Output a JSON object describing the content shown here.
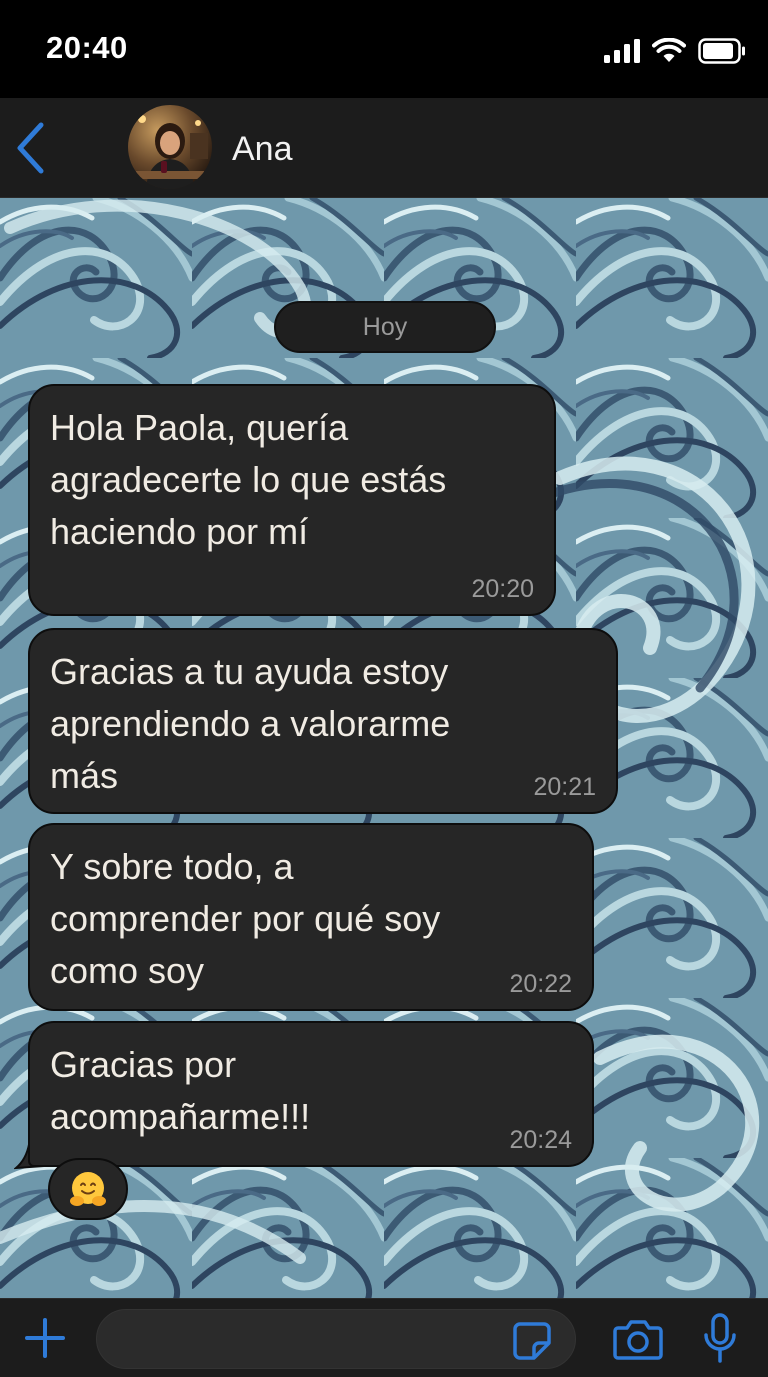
{
  "status_bar": {
    "time": "20:40"
  },
  "header": {
    "contact_name": "Ana"
  },
  "chat": {
    "date_separator": "Hoy",
    "messages": [
      {
        "text": "Hola Paola, quería\nagradecerte lo que estás\nhaciendo por mí",
        "time": "20:20"
      },
      {
        "text": "Gracias a tu ayuda estoy\naprendiendo a valorarme\nmás",
        "time": "20:21"
      },
      {
        "text": "Y sobre todo, a\ncomprender por qué soy\ncomo soy",
        "time": "20:22"
      },
      {
        "text": "Gracias por\nacompañarme!!!",
        "time": "20:24"
      }
    ],
    "reaction": {
      "emoji": "🤗"
    }
  },
  "input_bar": {
    "message_value": ""
  },
  "icons": {
    "back": "chevron-left-icon",
    "signal": "cellular-signal-icon",
    "wifi": "wifi-icon",
    "battery": "battery-icon",
    "plus": "plus-icon",
    "sticker": "sticker-icon",
    "camera": "camera-icon",
    "mic": "microphone-icon"
  },
  "colors": {
    "accent": "#2f7bd8",
    "bubble": "#262626",
    "bubble_text": "#f0ebe3",
    "time_text": "#9a9a9a",
    "wallpaper": "#6f98ab"
  }
}
